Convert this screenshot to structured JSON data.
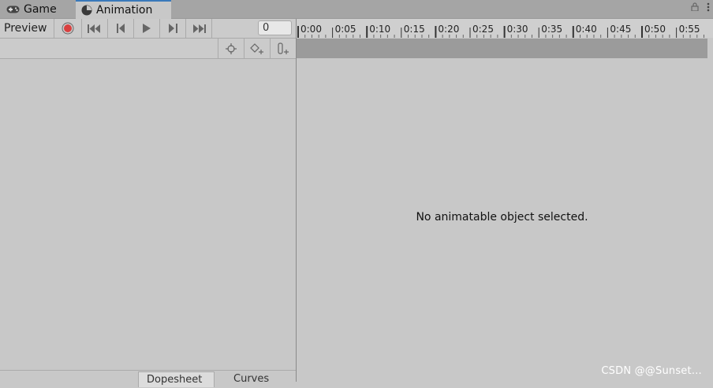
{
  "tabs": {
    "game_label": "Game",
    "animation_label": "Animation"
  },
  "toolbar": {
    "preview_label": "Preview",
    "frame_value": "0"
  },
  "timeline": {
    "ticks": [
      "0:00",
      "0:05",
      "0:10",
      "0:15",
      "0:20",
      "0:25",
      "0:30",
      "0:35",
      "0:40",
      "0:45",
      "0:50",
      "0:55"
    ]
  },
  "main": {
    "empty_message": "No animatable object selected."
  },
  "bottom_tabs": {
    "dopesheet_label": "Dopesheet",
    "curves_label": "Curves"
  },
  "watermark": "CSDN @@Sunset…",
  "colors": {
    "record_red": "#d9403f",
    "active_tab_accent": "#3a79bb"
  }
}
